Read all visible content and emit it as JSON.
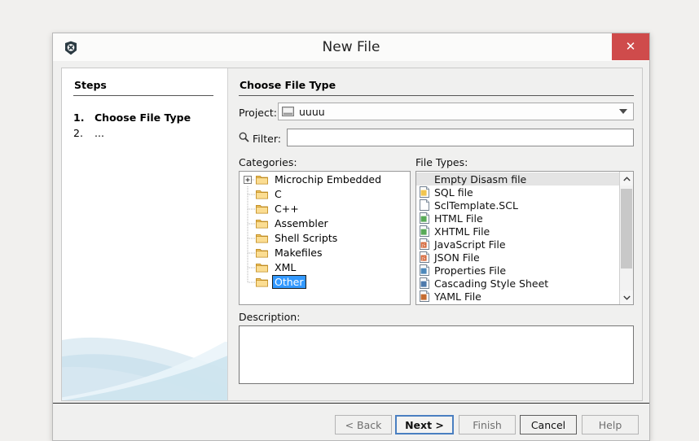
{
  "window": {
    "title": "New File",
    "app_icon": "app-x-icon",
    "close_icon": "close-icon",
    "close_label": "✕",
    "close_color": "#cf4b4b"
  },
  "steps": {
    "heading": "Steps",
    "items": [
      {
        "number": "1.",
        "label": "Choose File Type",
        "current": true
      },
      {
        "number": "2.",
        "label": "...",
        "current": false
      }
    ]
  },
  "main": {
    "section_title": "Choose File Type",
    "project": {
      "label": "Project:",
      "value": "uuuu",
      "icon": "project-folder-icon",
      "arrow_icon": "chevron-down-icon"
    },
    "filter": {
      "label": "Filter:",
      "value": "",
      "placeholder": "",
      "icon": "search-icon"
    },
    "categories": {
      "label": "Categories:",
      "items": [
        {
          "label": "Microchip Embedded",
          "expandable": true,
          "selected": false
        },
        {
          "label": "C",
          "expandable": false,
          "selected": false
        },
        {
          "label": "C++",
          "expandable": false,
          "selected": false
        },
        {
          "label": "Assembler",
          "expandable": false,
          "selected": false
        },
        {
          "label": "Shell Scripts",
          "expandable": false,
          "selected": false
        },
        {
          "label": "Makefiles",
          "expandable": false,
          "selected": false
        },
        {
          "label": "XML",
          "expandable": false,
          "selected": false
        },
        {
          "label": "Other",
          "expandable": false,
          "selected": true
        }
      ]
    },
    "file_types": {
      "label": "File Types:",
      "items": [
        {
          "label": "Empty Disasm file",
          "selected": true,
          "icon": "none",
          "icon_color": "#ffffff",
          "icon_text": ""
        },
        {
          "label": "SQL file",
          "selected": false,
          "icon": "sql-file-icon",
          "icon_color": "#f0c040",
          "icon_text": ""
        },
        {
          "label": "SclTemplate.SCL",
          "selected": false,
          "icon": "scl-file-icon",
          "icon_color": "#ffffff",
          "icon_text": "SCL"
        },
        {
          "label": "HTML File",
          "selected": false,
          "icon": "html-file-icon",
          "icon_color": "#4aa34a",
          "icon_text": ""
        },
        {
          "label": "XHTML File",
          "selected": false,
          "icon": "xhtml-file-icon",
          "icon_color": "#4aa34a",
          "icon_text": ""
        },
        {
          "label": "JavaScript File",
          "selected": false,
          "icon": "javascript-file-icon",
          "icon_color": "#d05a2a",
          "icon_text": "JS"
        },
        {
          "label": "JSON File",
          "selected": false,
          "icon": "json-file-icon",
          "icon_color": "#d05a2a",
          "icon_text": "JS"
        },
        {
          "label": "Properties File",
          "selected": false,
          "icon": "properties-file-icon",
          "icon_color": "#3f7fb5",
          "icon_text": ""
        },
        {
          "label": "Cascading Style Sheet",
          "selected": false,
          "icon": "css-file-icon",
          "icon_color": "#3f6fa5",
          "icon_text": ""
        },
        {
          "label": "YAML File",
          "selected": false,
          "icon": "yaml-file-icon",
          "icon_color": "#c06020",
          "icon_text": ""
        }
      ],
      "scrollbar": {
        "up_icon": "chevron-up-icon",
        "down_icon": "chevron-down-icon"
      }
    },
    "description": {
      "label": "Description:",
      "value": ""
    }
  },
  "footer": {
    "buttons": [
      {
        "label": "< Back",
        "state": "disabled"
      },
      {
        "label": "Next >",
        "state": "default"
      },
      {
        "label": "Finish",
        "state": "disabled"
      },
      {
        "label": "Cancel",
        "state": "enabled"
      },
      {
        "label": "Help",
        "state": "disabled"
      }
    ]
  },
  "colors": {
    "selection_blue": "#3399ff",
    "close_red": "#cf4b4b",
    "focus_border": "#4a7fc1",
    "dialog_bg": "#f0f0ef",
    "desktop_bg": "#f1f0ee"
  }
}
